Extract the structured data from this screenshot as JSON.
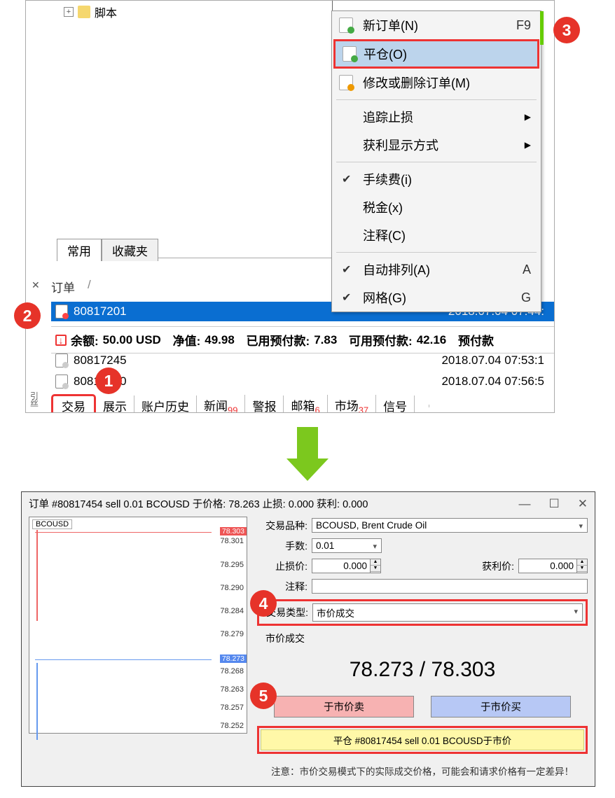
{
  "tree": {
    "script_label": "脚本"
  },
  "side_tabs": {
    "common": "常用",
    "favorites": "收藏夹"
  },
  "context_menu": {
    "new_order": "新订单(N)",
    "new_order_key": "F9",
    "close_pos": "平仓(O)",
    "modify": "修改或删除订单(M)",
    "trailing": "追踪止损",
    "profit_display": "获利显示方式",
    "commission": "手续费(i)",
    "tax": "税金(x)",
    "comment": "注释(C)",
    "auto_arrange": "自动排列(A)",
    "auto_arrange_key": "A",
    "grid": "网格(G)",
    "grid_key": "G"
  },
  "orders": {
    "header": "订单",
    "rows": [
      {
        "id": "80817201",
        "time": "2018.07.04 07:44:"
      },
      {
        "id": "80817245",
        "time": "2018.07.04 07:53:1"
      },
      {
        "id": "80817250",
        "time": "2018.07.04 07:56:5"
      }
    ]
  },
  "balance": {
    "label_balance": "余额:",
    "balance": "50.00 USD",
    "label_equity": "净值:",
    "equity": "49.98",
    "label_margin": "已用预付款:",
    "margin": "7.83",
    "label_free": "可用预付款:",
    "free": "42.16",
    "label_pre": "预付款"
  },
  "bottom_tabs": {
    "trade": "交易",
    "display": "展示",
    "history": "账户历史",
    "news": "新闻",
    "news_badge": "99",
    "alerts": "警报",
    "mail": "邮箱",
    "mail_badge": "6",
    "market": "市场",
    "market_badge": "37",
    "signals": "信号"
  },
  "dialog": {
    "title": "订单 #80817454 sell 0.01 BCOUSD 于价格: 78.263 止损: 0.000 获利: 0.000",
    "symbol_label": "交易品种:",
    "symbol": "BCOUSD, Brent Crude Oil",
    "volume_label": "手数:",
    "volume": "0.01",
    "sl_label": "止损价:",
    "sl": "0.000",
    "tp_label": "获利价:",
    "tp": "0.000",
    "comment_label": "注释:",
    "type_label": "交易类型:",
    "type": "市价成交",
    "mode_label": "市价成交",
    "bidask": "78.273 / 78.303",
    "sell_btn": "于市价卖",
    "buy_btn": "于市价买",
    "close_btn": "平仓 #80817454 sell 0.01 BCOUSD于市价",
    "note": "注意：市价交易模式下的实际成交价格，可能会和请求价格有一定差异！",
    "chart": {
      "title": "BCOUSD",
      "red_box": "78.303",
      "blue_box": "78.273",
      "ticks": [
        "78.301",
        "78.295",
        "78.290",
        "78.284",
        "78.279",
        "78.268",
        "78.263",
        "78.257",
        "78.252"
      ]
    }
  },
  "callouts": {
    "c1": "1",
    "c2": "2",
    "c3": "3",
    "c4": "4",
    "c5": "5"
  }
}
